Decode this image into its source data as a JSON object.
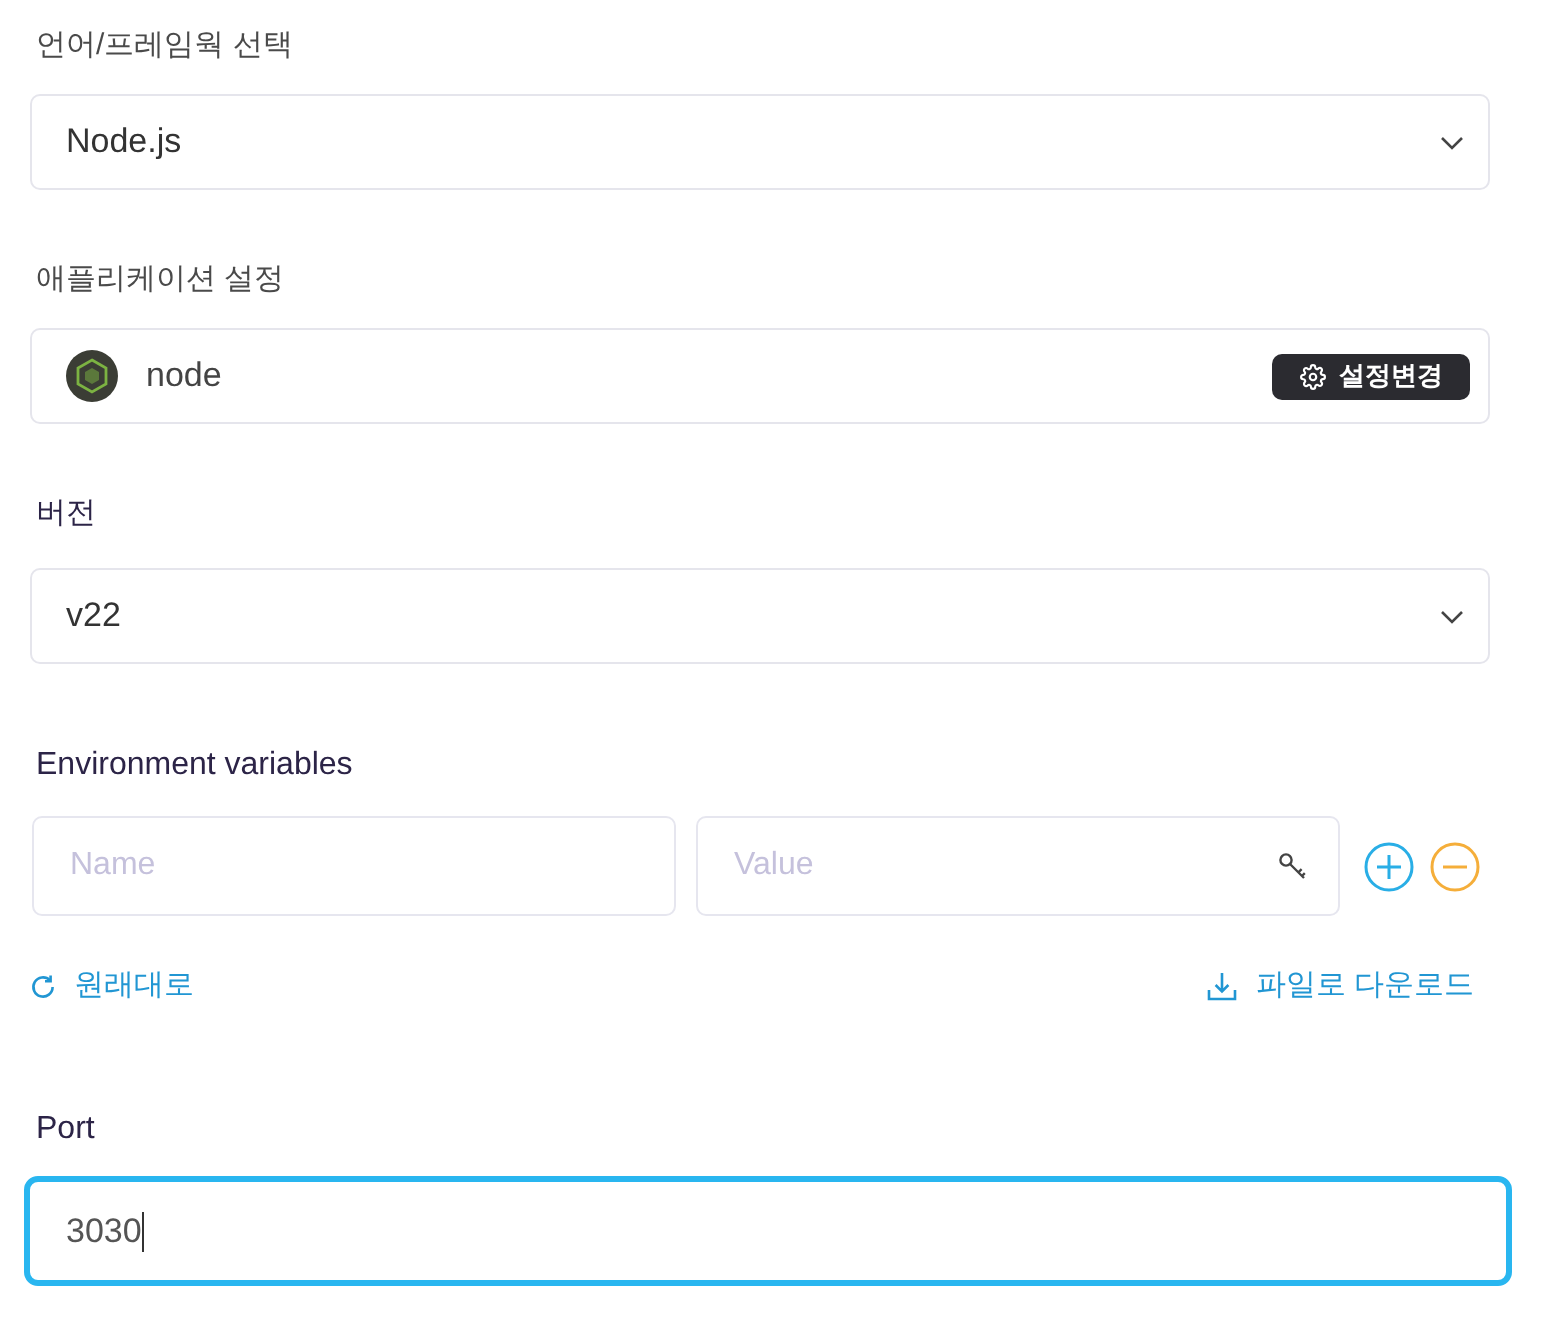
{
  "framework": {
    "label": "언어/프레임웍 선택",
    "value": "Node.js"
  },
  "application": {
    "label": "애플리케이션 설정",
    "name": "node",
    "button": "설정변경"
  },
  "version": {
    "label": "버전",
    "value": "v22"
  },
  "environment_variables": {
    "label": "Environment variables",
    "rows": [
      {
        "name": {
          "placeholder": "Name"
        },
        "value": {
          "placeholder": "Value"
        }
      }
    ],
    "reset_link": "원래대로",
    "download_link": "파일로 다운로드"
  },
  "port": {
    "label": "Port",
    "value": "3030",
    "focused": true
  }
}
